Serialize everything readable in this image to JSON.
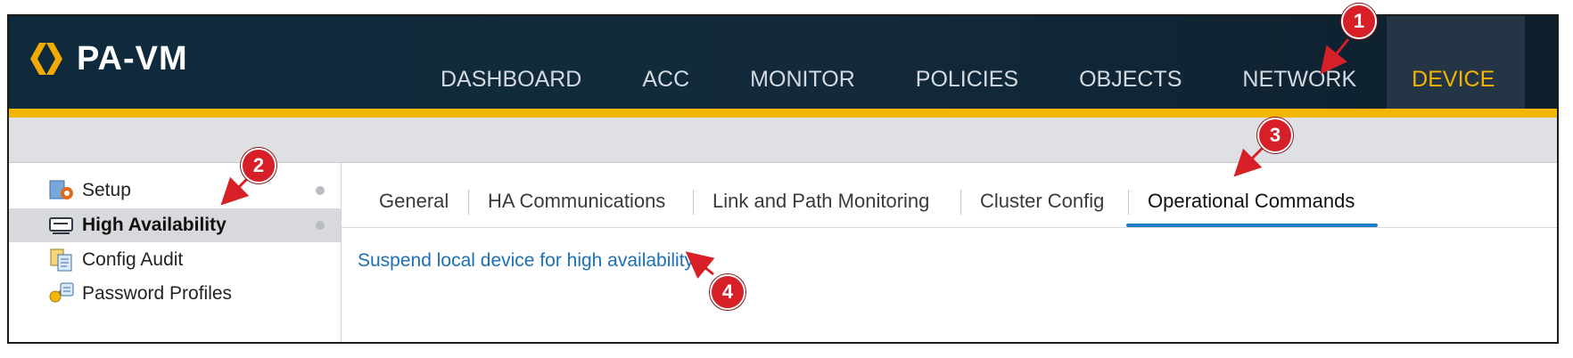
{
  "app": {
    "title": "PA-VM"
  },
  "nav": {
    "items": [
      {
        "label": "DASHBOARD"
      },
      {
        "label": "ACC"
      },
      {
        "label": "MONITOR"
      },
      {
        "label": "POLICIES"
      },
      {
        "label": "OBJECTS"
      },
      {
        "label": "NETWORK"
      },
      {
        "label": "DEVICE",
        "active": true
      }
    ]
  },
  "sidebar": {
    "items": [
      {
        "label": "Setup",
        "icon": "setup-icon"
      },
      {
        "label": "High Availability",
        "icon": "high-availability-icon",
        "selected": true
      },
      {
        "label": "Config Audit",
        "icon": "config-audit-icon"
      },
      {
        "label": "Password Profiles",
        "icon": "password-profiles-icon"
      }
    ]
  },
  "tabs": {
    "items": [
      {
        "label": "General"
      },
      {
        "label": "HA Communications"
      },
      {
        "label": "Link and Path Monitoring"
      },
      {
        "label": "Cluster Config"
      },
      {
        "label": "Operational Commands",
        "active": true
      }
    ]
  },
  "content": {
    "link_label": "Suspend local device for high availability"
  },
  "callouts": [
    "1",
    "2",
    "3",
    "4"
  ],
  "colors": {
    "header_bg": "#122a3c",
    "accent_gold": "#f2b705",
    "active_nav": "#f4b400",
    "link_blue": "#1d6fb8",
    "tab_underline": "#1f7fc4",
    "callout_red": "#d61f26"
  }
}
